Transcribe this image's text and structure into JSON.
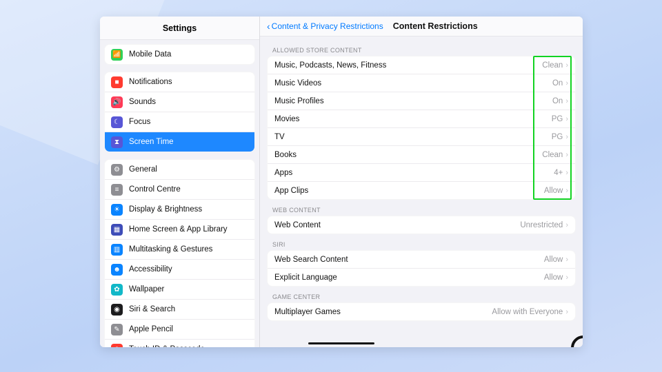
{
  "sidebar": {
    "title": "Settings",
    "group_mobile": {
      "label": "Mobile Data",
      "icon": "antenna",
      "color": "#30d158"
    },
    "group_notifications": [
      {
        "label": "Notifications",
        "icon": "bell",
        "color": "#ff3b30"
      },
      {
        "label": "Sounds",
        "icon": "speaker",
        "color": "#ff3b57"
      },
      {
        "label": "Focus",
        "icon": "moon",
        "color": "#5856d6"
      },
      {
        "label": "Screen Time",
        "icon": "hourglass",
        "color": "#5856d6",
        "selected": true
      }
    ],
    "group_general": [
      {
        "label": "General",
        "icon": "gear",
        "color": "#8e8e93"
      },
      {
        "label": "Control Centre",
        "icon": "switches",
        "color": "#8e8e93"
      },
      {
        "label": "Display & Brightness",
        "icon": "sun",
        "color": "#0a84ff"
      },
      {
        "label": "Home Screen & App Library",
        "icon": "grid",
        "color": "#3e4db8"
      },
      {
        "label": "Multitasking & Gestures",
        "icon": "split",
        "color": "#0a84ff"
      },
      {
        "label": "Accessibility",
        "icon": "person",
        "color": "#0a84ff"
      },
      {
        "label": "Wallpaper",
        "icon": "flower",
        "color": "#12b8c8"
      },
      {
        "label": "Siri & Search",
        "icon": "siri",
        "color": "#1c1c1e"
      },
      {
        "label": "Apple Pencil",
        "icon": "pencil",
        "color": "#8e8e93"
      },
      {
        "label": "Touch ID & Passcode",
        "icon": "fingerprint",
        "color": "#ff3b30"
      }
    ]
  },
  "header": {
    "back_label": "Content & Privacy Restrictions",
    "title": "Content Restrictions"
  },
  "sections": {
    "allowed_store": {
      "title": "ALLOWED STORE CONTENT",
      "rows": [
        {
          "label": "Music, Podcasts, News, Fitness",
          "value": "Clean"
        },
        {
          "label": "Music Videos",
          "value": "On"
        },
        {
          "label": "Music Profiles",
          "value": "On"
        },
        {
          "label": "Movies",
          "value": "PG"
        },
        {
          "label": "TV",
          "value": "PG"
        },
        {
          "label": "Books",
          "value": "Clean"
        },
        {
          "label": "Apps",
          "value": "4+"
        },
        {
          "label": "App Clips",
          "value": "Allow"
        }
      ]
    },
    "web_content": {
      "title": "WEB CONTENT",
      "rows": [
        {
          "label": "Web Content",
          "value": "Unrestricted"
        }
      ]
    },
    "siri": {
      "title": "SIRI",
      "rows": [
        {
          "label": "Web Search Content",
          "value": "Allow"
        },
        {
          "label": "Explicit Language",
          "value": "Allow"
        }
      ]
    },
    "game_center": {
      "title": "GAME CENTER",
      "rows": [
        {
          "label": "Multiplayer Games",
          "value": "Allow with Everyone"
        }
      ]
    }
  },
  "icon_glyphs": {
    "antenna": "📶",
    "bell": "■",
    "speaker": "🔊",
    "moon": "☾",
    "hourglass": "⧗",
    "gear": "⚙",
    "switches": "≡",
    "sun": "☀",
    "grid": "▦",
    "split": "▥",
    "person": "☻",
    "flower": "✿",
    "siri": "◉",
    "pencil": "✎",
    "fingerprint": "◉"
  }
}
